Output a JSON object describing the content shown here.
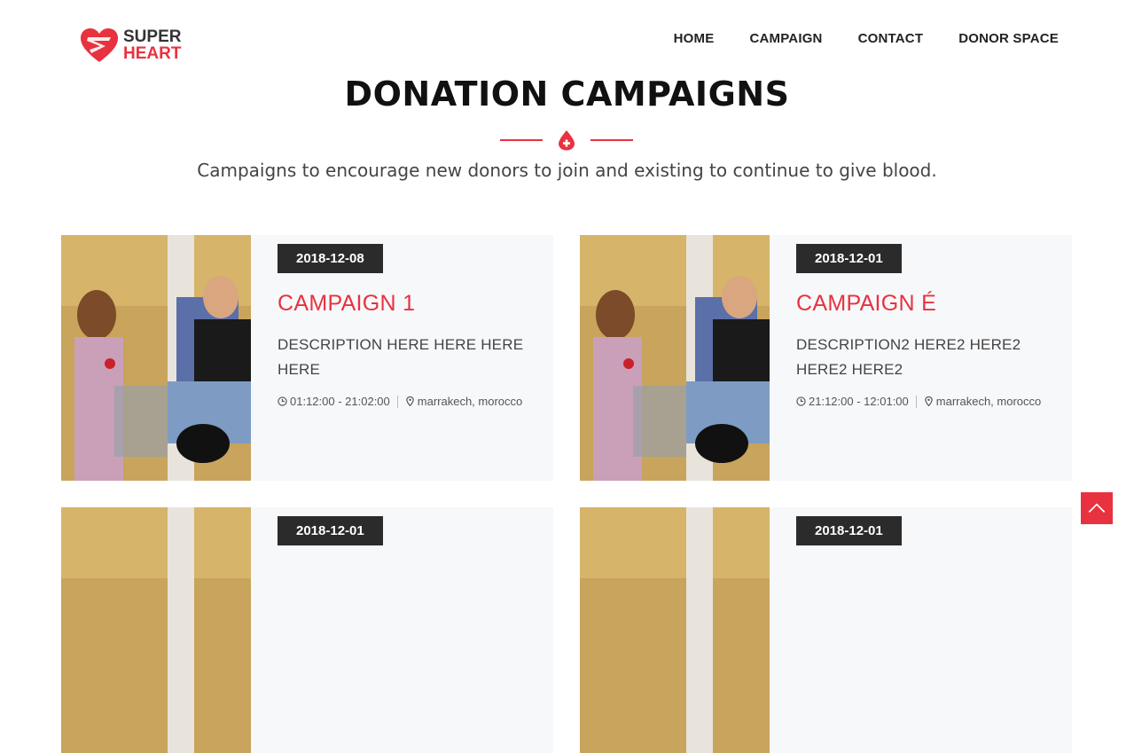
{
  "brand": {
    "line1": "SUPER",
    "line2": "HEART",
    "logo_icon": "heart-shield-icon",
    "accent": "#e8323f"
  },
  "nav": {
    "items": [
      {
        "label": "HOME"
      },
      {
        "label": "CAMPAIGN"
      },
      {
        "label": "CONTACT"
      },
      {
        "label": "DONOR SPACE"
      }
    ]
  },
  "hero": {
    "title": "DONATION CAMPAIGNS",
    "divider_icon": "blood-drop-plus-icon",
    "subtitle": "Campaigns to encourage new donors to join and existing to continue to give blood."
  },
  "campaigns": [
    {
      "date": "2018-12-08",
      "title": "CAMPAIGN 1",
      "description": "DESCRIPTION HERE HERE HERE HERE",
      "time": "01:12:00 - 21:02:00",
      "location": "marrakech, morocco"
    },
    {
      "date": "2018-12-01",
      "title": "CAMPAIGN É",
      "description": "DESCRIPTION2 HERE2 HERE2 HERE2 HERE2",
      "time": "21:12:00 - 12:01:00",
      "location": "marrakech, morocco"
    },
    {
      "date": "2018-12-01"
    },
    {
      "date": "2018-12-01"
    }
  ],
  "scroll_top_icon": "chevron-up-icon"
}
